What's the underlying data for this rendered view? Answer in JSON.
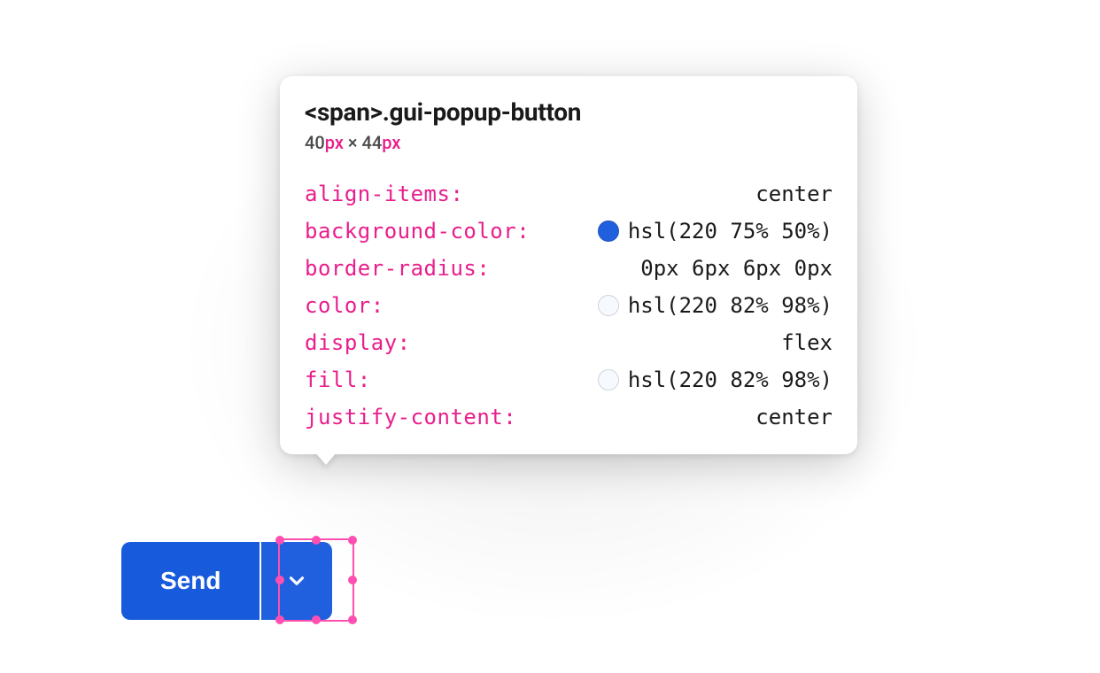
{
  "tooltip": {
    "selector": "<span>.gui-popup-button",
    "dimensions": {
      "width_value": "40",
      "width_unit": "px",
      "separator": " × ",
      "height_value": "44",
      "height_unit": "px"
    },
    "properties": [
      {
        "name": "align-items:",
        "value": "center",
        "swatch": null
      },
      {
        "name": "background-color:",
        "value": "hsl(220 75% 50%)",
        "swatch": "blue"
      },
      {
        "name": "border-radius:",
        "value": "0px 6px 6px 0px",
        "swatch": null
      },
      {
        "name": "color:",
        "value": "hsl(220 82% 98%)",
        "swatch": "white"
      },
      {
        "name": "display:",
        "value": "flex",
        "swatch": null
      },
      {
        "name": "fill:",
        "value": "hsl(220 82% 98%)",
        "swatch": "white"
      },
      {
        "name": "justify-content:",
        "value": "center",
        "swatch": null
      }
    ]
  },
  "button": {
    "send_label": "Send"
  },
  "colors": {
    "accent_blue": "hsl(220 75% 50%)",
    "text_light": "hsl(220 82% 98%)",
    "pink": "#e91e8c",
    "selection_pink": "#ff4fb0"
  }
}
